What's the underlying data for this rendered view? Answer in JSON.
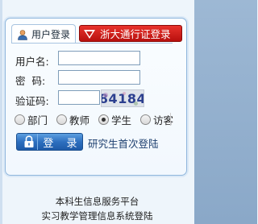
{
  "tabs": {
    "user_login": "用户登录",
    "pass_login": "浙大通行证登录"
  },
  "form": {
    "username_label": "用户名:",
    "username_value": "",
    "password_label": "密  码:",
    "password_value": "",
    "captcha_label": "验证码:",
    "captcha_value": "",
    "captcha_image_text": "84184"
  },
  "roles": {
    "options": [
      "部门",
      "教师",
      "学生",
      "访客"
    ],
    "selected": "学生"
  },
  "actions": {
    "login_label": "登 录",
    "grad_first_login": "研究生首次登陆"
  },
  "footer": {
    "line1": "本科生信息服务平台",
    "line2": "实习教学管理信息系统登陆"
  },
  "colors": {
    "pass_tab_bg": "#d22420",
    "login_btn_bg": "#2d6fbf",
    "panel_border": "#8fb6dc",
    "right_strip": "#9db8d4"
  }
}
